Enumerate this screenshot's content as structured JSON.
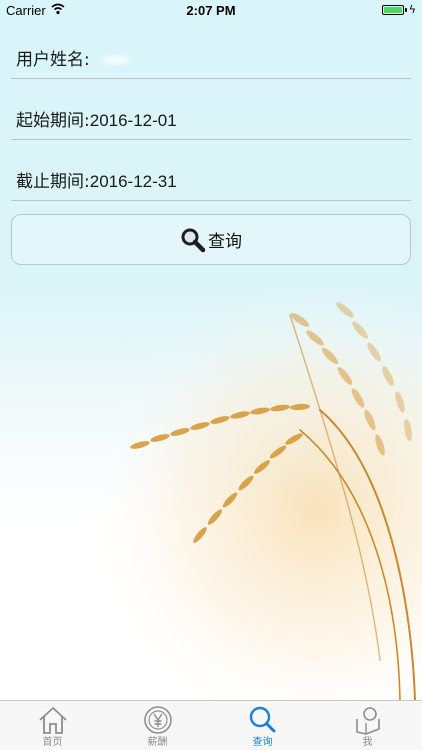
{
  "status_bar": {
    "carrier": "Carrier",
    "time": "2:07 PM",
    "battery_color": "#4cd964"
  },
  "form": {
    "user_name_label": "用户姓名:",
    "start_label": "起始期间:",
    "start_value": "2016-12-01",
    "end_label": "截止期间:",
    "end_value": "2016-12-31"
  },
  "query_button": {
    "label": "查询",
    "icon": "search-icon"
  },
  "tabbar": {
    "active_color": "#1a7fe0",
    "inactive_color": "#8e8e8e",
    "tabs": [
      {
        "label": "首页",
        "icon": "home-icon",
        "active": false
      },
      {
        "label": "薪酬",
        "icon": "yen-coin-icon",
        "active": false
      },
      {
        "label": "查询",
        "icon": "search-icon",
        "active": true
      },
      {
        "label": "我",
        "icon": "profile-icon",
        "active": false
      }
    ]
  }
}
